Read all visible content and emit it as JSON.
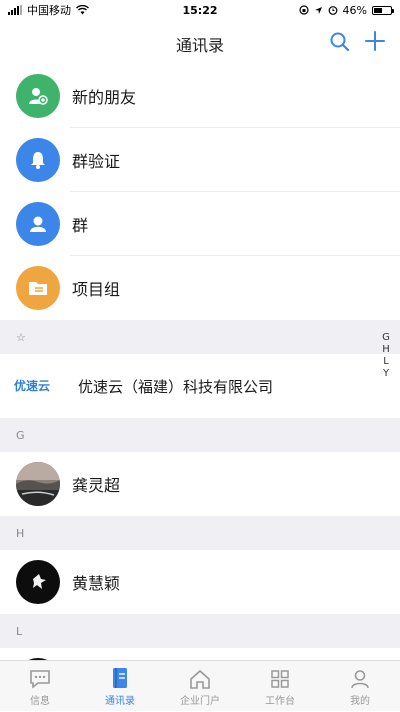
{
  "status_bar": {
    "carrier": "中国移动",
    "time": "15:22",
    "battery": "46%"
  },
  "nav": {
    "title": "通讯录"
  },
  "entries": [
    {
      "label": "新的朋友",
      "color": "#3fb36b",
      "icon": "new-friend-icon"
    },
    {
      "label": "群验证",
      "color": "#3b86e8",
      "icon": "bell-icon"
    },
    {
      "label": "群",
      "color": "#3b86e8",
      "icon": "group-icon"
    },
    {
      "label": "项目组",
      "color": "#f0a640",
      "icon": "folder-icon"
    }
  ],
  "sections": {
    "star": "☆",
    "g": "G",
    "h": "H",
    "l": "L"
  },
  "company": {
    "logo_text": "优速云",
    "name": "优速云（福建）科技有限公司"
  },
  "contacts": {
    "g": "龚灵超",
    "h": "黄慧颖"
  },
  "index_letters": [
    "G",
    "H",
    "L",
    "Y"
  ],
  "tabs": [
    {
      "label": "信息",
      "icon": "chat-icon",
      "active": false
    },
    {
      "label": "通讯录",
      "icon": "contacts-book-icon",
      "active": true
    },
    {
      "label": "企业门户",
      "icon": "home-icon",
      "active": false
    },
    {
      "label": "工作台",
      "icon": "grid-icon",
      "active": false
    },
    {
      "label": "我的",
      "icon": "person-icon",
      "active": false
    }
  ],
  "colors": {
    "accent": "#3b86e8",
    "section_bg": "#efeff4"
  }
}
